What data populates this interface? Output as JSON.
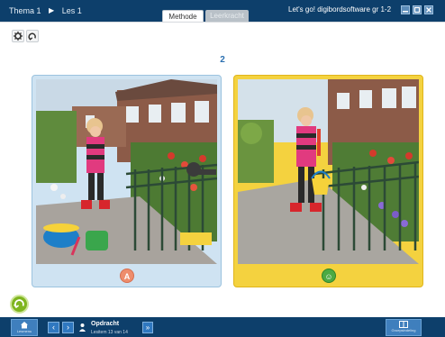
{
  "header": {
    "breadcrumb": [
      "Thema 1",
      "Les 1"
    ],
    "tabs": [
      {
        "label": "Methode",
        "active": true
      },
      {
        "label": "Leerkracht",
        "active": false
      }
    ],
    "app_title": "Let's go! digibordsoftware gr 1-2",
    "window_buttons": [
      "minimize-icon",
      "restore-icon",
      "close-icon"
    ]
  },
  "toolbar": {
    "icons": [
      "gear-icon",
      "undo-icon"
    ]
  },
  "page": {
    "number": "2"
  },
  "cards": [
    {
      "badge_label": "A",
      "selected": false,
      "badge_icon": "letter-a-badge"
    },
    {
      "badge_label": "☺",
      "selected": true,
      "badge_icon": "smiley-icon"
    }
  ],
  "footer": {
    "home_label": "Lesmenu",
    "prev_label": "‹",
    "next_label": "›",
    "title": "Opdracht",
    "subtitle": "Lesitem 13 van 14",
    "skip_label": "»",
    "right_label": "Groepsindeling"
  },
  "colors": {
    "bar": "#0d3f6b",
    "card_a": "#cfe3f2",
    "card_b_selected": "#f4d23f",
    "page_number": "#2a6fb0",
    "replay": "#7fb51f"
  }
}
